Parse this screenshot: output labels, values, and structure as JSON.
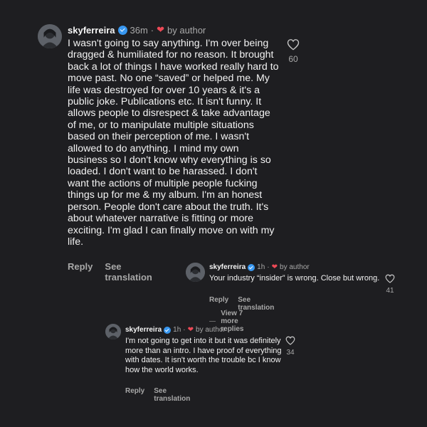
{
  "colors": {
    "background": "#1e1e21",
    "verified": "#3897f0",
    "heart": "#ed4956",
    "muted": "#a8a8a8"
  },
  "icons": {
    "verified": "verified-badge-icon",
    "author_heart": "heart-icon",
    "like": "heart-outline-icon"
  },
  "comments": [
    {
      "username": "skyferreira",
      "time": "36m",
      "separator": "·",
      "heart": "❤",
      "by_author": "by author",
      "text": "I wasn't going to say anything. I'm over being dragged & humiliated for no reason. It brought back a lot of things I have worked really hard to move past. No one “saved” or helped me. My life was destroyed for over 10 years & it's a public joke. Publications etc. It isn't funny. It allows people to disrespect & take advantage of me, or to manipulate multiple situations based on their perception of me. I wasn't allowed to do anything. I mind my own business so I don't know why everything is so loaded. I don't want to be harassed. I don't want the actions of multiple people fucking things up for me & my album. I'm an honest person. People don't care about the truth. It's about whatever narrative is fitting or more exciting. I'm glad I can finally move on with my life.",
      "reply_label": "Reply",
      "translate_label": "See translation",
      "likes": "60"
    },
    {
      "username": "skyferreira",
      "time": "1h",
      "separator": "·",
      "heart": "❤",
      "by_author": "by author",
      "text": "Your industry “insider” is wrong. Close but wrong.",
      "reply_label": "Reply",
      "translate_label": "See translation",
      "likes": "41",
      "view_more": "View 7 more replies"
    },
    {
      "username": "skyferreira",
      "time": "1h",
      "separator": "·",
      "heart": "❤",
      "by_author": "by author",
      "text": "I'm not going to get into it but it was definitely more than an intro. I have proof of everything with dates. It isn't worth the trouble bc I know how the world works.",
      "reply_label": "Reply",
      "translate_label": "See translation",
      "likes": "34"
    }
  ]
}
